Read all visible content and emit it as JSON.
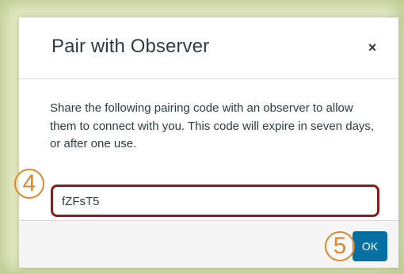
{
  "dialog": {
    "title": "Pair with Observer",
    "close_label": "×",
    "description": "Share the following pairing code with an observer to allow them to connect with you. This code will expire in seven days, or after one use.",
    "pairing_code": "fZFsT5",
    "ok_label": "OK"
  },
  "annotations": {
    "step_code": "4",
    "step_ok": "5"
  },
  "colors": {
    "backdrop": "#e9edcb",
    "highlight_border": "#8c1c1c",
    "ok_button": "#0770a3",
    "step_badge": "#e0872b",
    "text": "#2d3b45"
  },
  "icons": {
    "close": "close-icon"
  }
}
